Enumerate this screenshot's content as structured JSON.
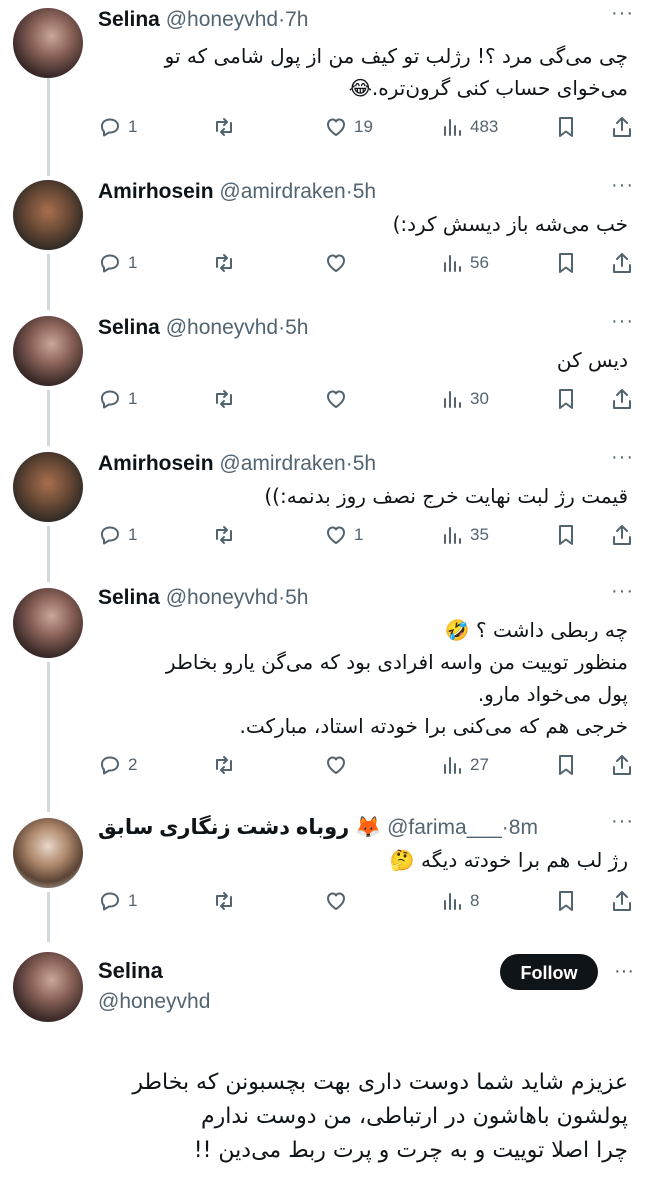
{
  "replies": [
    {
      "name": "Selina",
      "handle": "@honeyvhd",
      "time": "7h",
      "avatar": "selina",
      "text": "چی می‌گی مرد ؟! رژلب تو کیف من از پول شامی که تو\nمی‌خوای حساب کنی گرون‌تره.😂",
      "reply": "1",
      "retweet": "",
      "like": "19",
      "views": "483"
    },
    {
      "name": "Amirhosein",
      "handle": "@amirdraken",
      "time": "5h",
      "avatar": "amir",
      "text": "خب می‌شه باز دیسش کرد:)",
      "reply": "1",
      "retweet": "",
      "like": "",
      "views": "56"
    },
    {
      "name": "Selina",
      "handle": "@honeyvhd",
      "time": "5h",
      "avatar": "selina",
      "text": "دیس کن",
      "reply": "1",
      "retweet": "",
      "like": "",
      "views": "30"
    },
    {
      "name": "Amirhosein",
      "handle": "@amirdraken",
      "time": "5h",
      "avatar": "amir",
      "text": "قیمت رژ لبت نهایت خرج نصف روز بدنمه:))",
      "reply": "1",
      "retweet": "",
      "like": "1",
      "views": "35"
    },
    {
      "name": "Selina",
      "handle": "@honeyvhd",
      "time": "5h",
      "avatar": "selina",
      "text": "چه ربطی داشت ؟ 🤣\nمنظور توییت من واسه افرادی بود که می‌گن یارو بخاطر\nپول می‌خواد مارو.\nخرجی هم که می‌کنی برا خودته استاد، مبارکت.",
      "reply": "2",
      "retweet": "",
      "like": "",
      "views": "27"
    },
    {
      "name": "روباه دشت زنگاری سابق 🦊",
      "handle": "@farima___",
      "time": "8m",
      "avatar": "farima",
      "text": "رژ لب هم برا خودته دیگه 🤔",
      "reply": "1",
      "retweet": "",
      "like": "",
      "views": "8"
    }
  ],
  "main": {
    "name": "Selina",
    "handle": "@honeyvhd",
    "follow_label": "Follow",
    "text": "عزیزم شاید شما دوست داری بهت بچسبونن که بخاطر\nپولشون باهاشون در ارتباطی، من دوست ندارم\nچرا اصلا توییت و به چرت و پرت ربط می‌دین !!"
  },
  "colors": {
    "accent": "#0f1419",
    "muted": "#536471",
    "line": "#cfd9de"
  }
}
